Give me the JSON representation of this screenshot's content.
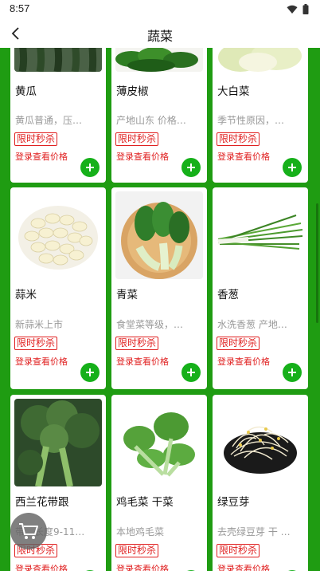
{
  "status": {
    "time": "8:57",
    "wifi_icon": "wifi-icon",
    "battery_icon": "battery-icon"
  },
  "nav": {
    "title": "蔬菜",
    "back_icon": "chevron-left-icon"
  },
  "cards": [
    {
      "name": "黄瓜",
      "desc": "黄瓜普通，压…",
      "badge": "限时秒杀",
      "login": "登录查看价格"
    },
    {
      "name": "薄皮椒",
      "desc": "产地山东 价格…",
      "badge": "限时秒杀",
      "login": "登录查看价格"
    },
    {
      "name": "大白菜",
      "desc": "季节性原因，…",
      "badge": "限时秒杀",
      "login": "登录查看价格"
    },
    {
      "name": "蒜米",
      "desc": "新蒜米上市",
      "badge": "限时秒杀",
      "login": "登录查看价格"
    },
    {
      "name": "青菜",
      "desc": "食堂菜等级，…",
      "badge": "限时秒杀",
      "login": "登录查看价格"
    },
    {
      "name": "香葱",
      "desc": "水洗香葱 产地…",
      "badge": "限时秒杀",
      "login": "登录查看价格"
    },
    {
      "name": "西兰花带跟",
      "desc": "带…长度9-11…",
      "badge": "限时秒杀",
      "login": "登录查看价格"
    },
    {
      "name": "鸡毛菜 干菜",
      "desc": "本地鸡毛菜",
      "badge": "限时秒杀",
      "login": "登录查看价格"
    },
    {
      "name": "绿豆芽",
      "desc": "去壳绿豆芽 干 …",
      "badge": "限时秒杀",
      "login": "登录查看价格"
    }
  ],
  "cart": {
    "icon": "shopping-cart-icon"
  },
  "colors": {
    "green_bg": "#1f9c12",
    "accent_red": "#e02020",
    "add_green": "#16b01a"
  }
}
